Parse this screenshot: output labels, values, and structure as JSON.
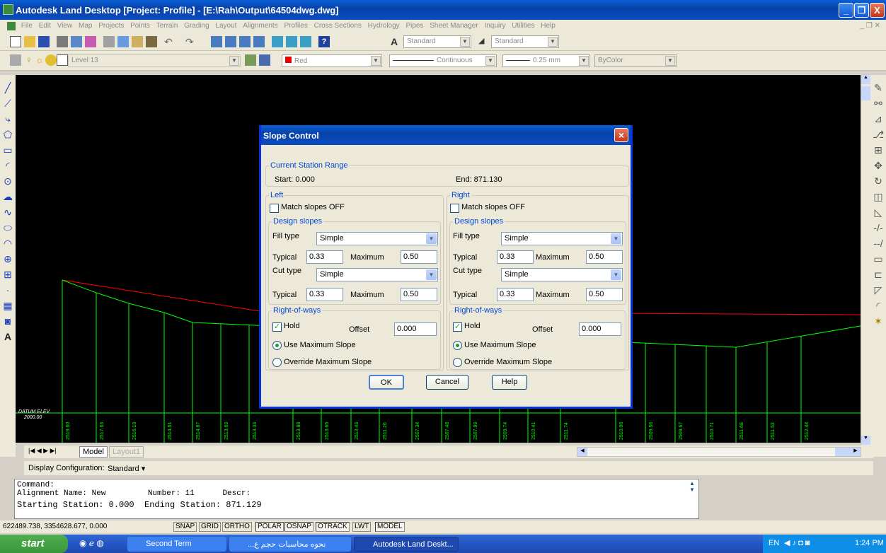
{
  "window": {
    "title": "Autodesk Land Desktop [Project: Profile] - [E:\\Rah\\Output\\64504dwg.dwg]",
    "minimize": "_",
    "maximize": "❐",
    "close": "X"
  },
  "menubar": [
    "File",
    "Edit",
    "View",
    "Map",
    "Projects",
    "Points",
    "Terrain",
    "Grading",
    "Layout",
    "Alignments",
    "Profiles",
    "Cross Sections",
    "Hydrology",
    "Pipes",
    "Sheet Manager",
    "Inquiry",
    "Utilities",
    "Help"
  ],
  "toolbar": {
    "text_style": "Standard",
    "dim_style": "Standard",
    "layer": "Level 13",
    "color": "Red",
    "linetype": "Continuous",
    "lineweight": "0.25 mm",
    "plotstyle": "ByColor"
  },
  "colors": {
    "titlebar": "#0a4bbf",
    "profile_line": "#00ff00",
    "ground_line": "#ff0000"
  },
  "profile": {
    "datum_label": "DATUM ELEV",
    "datum_value": "2000.00",
    "stations": [
      "2519.60",
      "2517.63",
      "2516.19",
      "2514.51",
      "2514.87",
      "2513.69",
      "2513.33",
      "2513.88",
      "2513.65",
      "2513.43",
      "2511.26",
      "2507.34",
      "2507.48",
      "2507.99",
      "2509.74",
      "2510.41",
      "2511.74",
      "2510.06",
      "2509.56",
      "2509.67",
      "2510.71",
      "2511.68",
      "2511.53",
      "2512.44"
    ]
  },
  "tabs": {
    "model": "Model",
    "layout": "Layout1"
  },
  "display_config": {
    "label": "Display Configuration:",
    "value": "Standard ▾"
  },
  "command": {
    "line1": "Command:",
    "line2": "Alignment Name: New         Number: 11      Descr:",
    "line3": "Starting Station: 0.000  Ending Station: 871.129"
  },
  "status": {
    "coords": "622489.738, 3354628.677, 0.000",
    "buttons": [
      "SNAP",
      "GRID",
      "ORTHO",
      "POLAR",
      "OSNAP",
      "OTRACK",
      "LWT",
      "MODEL"
    ]
  },
  "taskbar": {
    "start": "start",
    "tasks": [
      "Second Term",
      "...نحوه محاسبات حجم ع",
      "Autodesk Land Deskt..."
    ],
    "lang": "EN",
    "time": "1:24 PM"
  },
  "dialog": {
    "title": "Slope Control",
    "range_group": "Current Station Range",
    "start": "Start: 0.000",
    "end": "End: 871.130",
    "left": {
      "group": "Left",
      "match": "Match slopes OFF",
      "design": "Design slopes",
      "fill_type_label": "Fill type",
      "fill_type": "Simple",
      "typical_label": "Typical",
      "fill_typical": "0.33",
      "maximum_label": "Maximum",
      "fill_max": "0.50",
      "cut_type_label": "Cut type",
      "cut_type": "Simple",
      "cut_typical": "0.33",
      "cut_max": "0.50",
      "row_group": "Right-of-ways",
      "hold": "Hold",
      "offset_label": "Offset",
      "offset": "0.000",
      "use_max": "Use Maximum Slope",
      "override": "Override Maximum Slope"
    },
    "right": {
      "group": "Right",
      "match": "Match slopes OFF",
      "design": "Design slopes",
      "fill_type_label": "Fill type",
      "fill_type": "Simple",
      "typical_label": "Typical",
      "fill_typical": "0.33",
      "maximum_label": "Maximum",
      "fill_max": "0.50",
      "cut_type_label": "Cut type",
      "cut_type": "Simple",
      "cut_typical": "0.33",
      "cut_max": "0.50",
      "row_group": "Right-of-ways",
      "hold": "Hold",
      "offset_label": "Offset",
      "offset": "0.000",
      "use_max": "Use Maximum Slope",
      "override": "Override Maximum Slope"
    },
    "ok": "OK",
    "cancel": "Cancel",
    "help": "Help"
  }
}
